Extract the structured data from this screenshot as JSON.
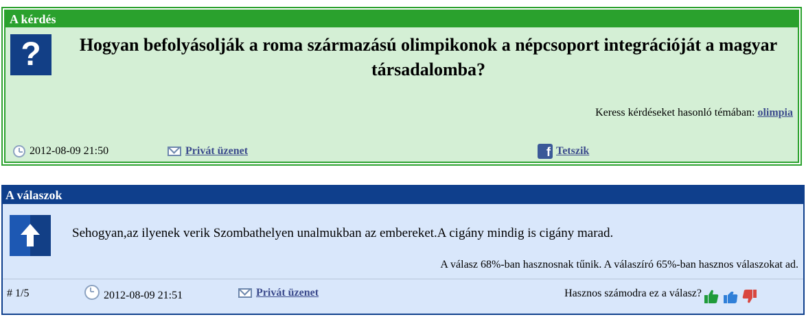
{
  "question": {
    "header": "A kérdés",
    "icon": "question-mark-icon",
    "title": "Hogyan befolyásolják a roma származású olimpikonok a népcsoport integrációját a magyar társadalomba?",
    "related_prefix": "Keress kérdéseket hasonló témában:",
    "related_tag": "olimpia",
    "date": "2012-08-09 21:50",
    "private_message": "Privát üzenet",
    "like": "Tetszik",
    "colors": {
      "header": "#2aa12d",
      "background": "#d4efd5"
    }
  },
  "answers": {
    "header": "A válaszok",
    "colors": {
      "header": "#0f3f8c",
      "background": "#d9e7fb"
    },
    "items": [
      {
        "icon": "arrow-up-icon",
        "text": "Sehogyan,az ilyenek verik Szombathelyen unalmukban az embereket.A cigány mindig is cigány marad.",
        "rating": "A válasz 68%-ban hasznosnak tűnik. A válaszíró 65%-ban hasznos válaszokat ad.",
        "number": "# 1/5",
        "date": "2012-08-09 21:51",
        "private_message": "Privát üzenet",
        "useful_question": "Hasznos számodra ez a válasz?"
      }
    ]
  }
}
